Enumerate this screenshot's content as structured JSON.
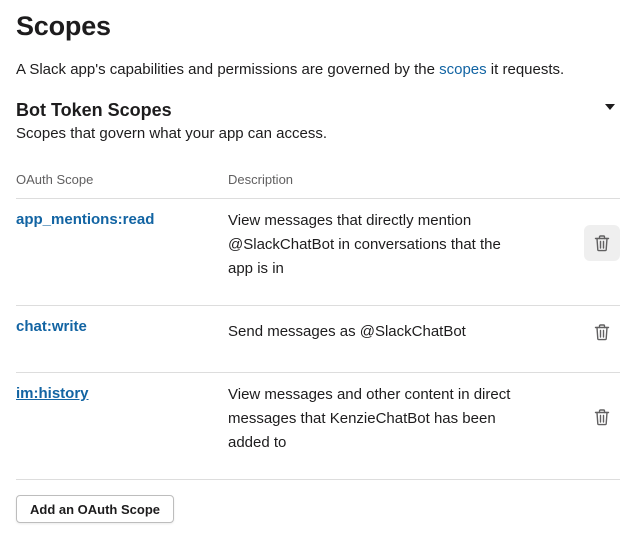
{
  "page": {
    "title": "Scopes",
    "intro_before": "A Slack app's capabilities and permissions are governed by the ",
    "intro_link": "scopes",
    "intro_after": " it requests."
  },
  "section": {
    "title": "Bot Token Scopes",
    "subtitle": "Scopes that govern what your app can access."
  },
  "table": {
    "headers": {
      "scope": "OAuth Scope",
      "description": "Description"
    },
    "rows": [
      {
        "scope": "app_mentions:read",
        "description_lines": [
          "View messages that directly mention",
          "@SlackChatBot in conversations that the",
          "app is in"
        ],
        "delete_icon": "trash-icon"
      },
      {
        "scope": "chat:write",
        "description_lines": [
          "Send messages as @SlackChatBot"
        ],
        "delete_icon": "trash-icon"
      },
      {
        "scope": "im:history",
        "description_lines": [
          "View messages and other content in direct",
          "messages that KenzieChatBot has been",
          "added to"
        ],
        "delete_icon": "trash-icon"
      }
    ]
  },
  "add_button_label": "Add an OAuth Scope",
  "colors": {
    "link": "#1264a3",
    "text": "#1d1c1d",
    "muted": "#616061",
    "divider": "#dddddd"
  }
}
